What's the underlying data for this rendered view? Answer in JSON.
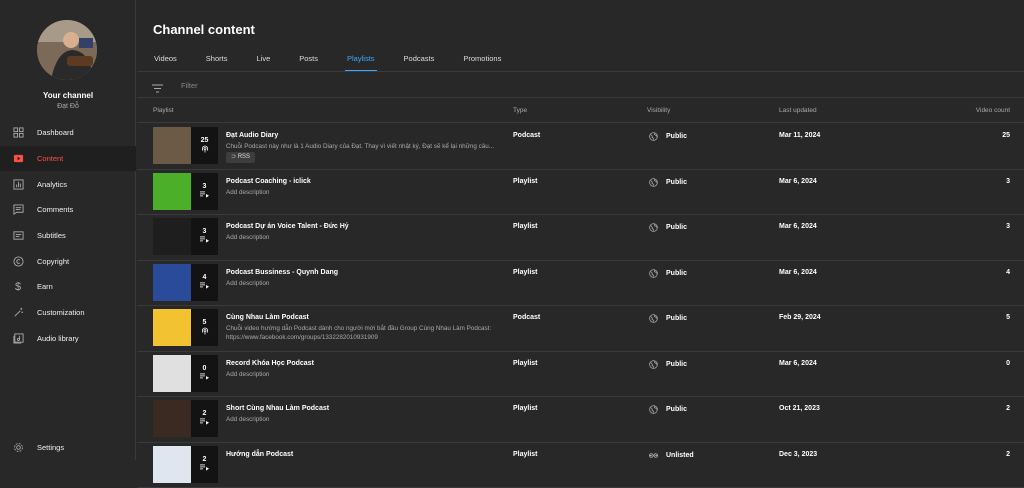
{
  "sidebar": {
    "channel_title": "Your channel",
    "channel_name": "Đạt Đỗ",
    "items": [
      {
        "label": "Dashboard",
        "icon": "dashboard-icon"
      },
      {
        "label": "Content",
        "icon": "content-icon",
        "active": true
      },
      {
        "label": "Analytics",
        "icon": "analytics-icon"
      },
      {
        "label": "Comments",
        "icon": "comments-icon"
      },
      {
        "label": "Subtitles",
        "icon": "subtitles-icon"
      },
      {
        "label": "Copyright",
        "icon": "copyright-icon"
      },
      {
        "label": "Earn",
        "icon": "dollar-icon"
      },
      {
        "label": "Customization",
        "icon": "wand-icon"
      },
      {
        "label": "Audio library",
        "icon": "audio-library-icon"
      }
    ],
    "settings_label": "Settings"
  },
  "header": {
    "title": "Channel content",
    "tabs": [
      "Videos",
      "Shorts",
      "Live",
      "Posts",
      "Playlists",
      "Podcasts",
      "Promotions"
    ],
    "active_tab": "Playlists"
  },
  "filter": {
    "placeholder": "Filter"
  },
  "table": {
    "columns": [
      "Playlist",
      "Type",
      "Visibility",
      "Last updated",
      "Video count"
    ],
    "rows": [
      {
        "title": "Đạt Audio Diary",
        "description": "Chuỗi Podcast này như là 1 Audio Diary của Đạt. Thay vì viết nhật ký, Đạt sẽ kể lại những câu...",
        "badge": "RSS",
        "type": "Podcast",
        "visibility": "Public",
        "updated": "Mar 11, 2024",
        "count": "25",
        "thumb_count": "25",
        "thumb_kind": "podcast",
        "thumb_color": "#6b5a46"
      },
      {
        "title": "Podcast Coaching - iclick",
        "description": "Add description",
        "type": "Playlist",
        "visibility": "Public",
        "updated": "Mar 6, 2024",
        "count": "3",
        "thumb_count": "3",
        "thumb_kind": "playlist",
        "thumb_color": "#4caf2a"
      },
      {
        "title": "Podcast Dự án Voice Talent - Đức Hỷ",
        "description": "Add description",
        "type": "Playlist",
        "visibility": "Public",
        "updated": "Mar 6, 2024",
        "count": "3",
        "thumb_count": "3",
        "thumb_kind": "playlist",
        "thumb_color": "#1e1e1e"
      },
      {
        "title": "Podcast Bussiness - Quynh Dang",
        "description": "Add description",
        "type": "Playlist",
        "visibility": "Public",
        "updated": "Mar 6, 2024",
        "count": "4",
        "thumb_count": "4",
        "thumb_kind": "playlist",
        "thumb_color": "#2a4a9a"
      },
      {
        "title": "Cùng Nhau Làm Podcast",
        "description": "Chuỗi video hướng dẫn Podcast dành cho người mới bắt đầu Group Cùng Nhau Làm Podcast: https://www.facebook.com/groups/1332282010931909",
        "type": "Podcast",
        "visibility": "Public",
        "updated": "Feb 29, 2024",
        "count": "5",
        "thumb_count": "5",
        "thumb_kind": "podcast",
        "thumb_color": "#f2c230"
      },
      {
        "title": "Record Khóa Học Podcast",
        "description": "Add description",
        "type": "Playlist",
        "visibility": "Public",
        "updated": "Mar 6, 2024",
        "count": "0",
        "thumb_count": "0",
        "thumb_kind": "playlist",
        "thumb_color": "#e0e0e0"
      },
      {
        "title": "Short Cùng Nhau Làm Podcast",
        "description": "Add description",
        "type": "Playlist",
        "visibility": "Public",
        "updated": "Oct 21, 2023",
        "count": "2",
        "thumb_count": "2",
        "thumb_kind": "playlist",
        "thumb_color": "#3a2a22"
      },
      {
        "title": "Hướng dẫn Podcast",
        "description": "",
        "type": "Playlist",
        "visibility": "Unlisted",
        "updated": "Dec 3, 2023",
        "count": "2",
        "thumb_count": "2",
        "thumb_kind": "playlist",
        "thumb_color": "#dfe6ef"
      }
    ]
  }
}
